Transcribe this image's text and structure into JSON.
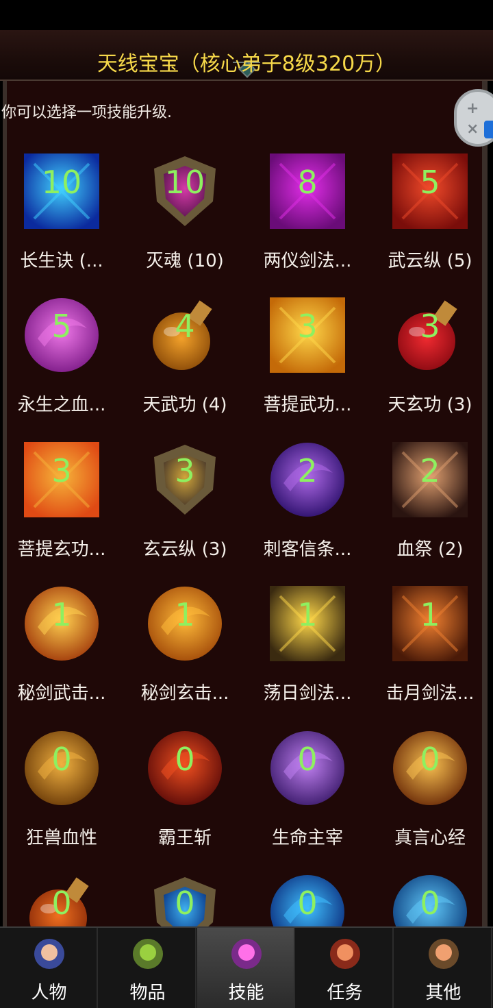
{
  "header": {
    "title": "天线宝宝（核心弟子8级320万）"
  },
  "hint": "你可以选择一项技能升级.",
  "skills": [
    {
      "name": "长生诀 (...",
      "level": "10",
      "icon": "figure-aura-icon",
      "shape": "square",
      "colors": [
        "#0b2a9e",
        "#42d2ff"
      ]
    },
    {
      "name": "灭魂 (10)",
      "level": "10",
      "icon": "gem-crest-icon",
      "shape": "crest",
      "colors": [
        "#5e1552",
        "#d63aa8"
      ]
    },
    {
      "name": "两仪剑法...",
      "level": "8",
      "icon": "crossed-swords-icon",
      "shape": "square",
      "colors": [
        "#6a0c78",
        "#e22ee8"
      ]
    },
    {
      "name": "武云纵 (5)",
      "level": "5",
      "icon": "flame-blade-icon",
      "shape": "square",
      "colors": [
        "#7a0d0a",
        "#f04a2a"
      ]
    },
    {
      "name": "永生之血...",
      "level": "5",
      "icon": "swirl-orb-icon",
      "shape": "circle",
      "colors": [
        "#7b1a86",
        "#ef78e8"
      ]
    },
    {
      "name": "天武功 (4)",
      "level": "4",
      "icon": "potion-orange-icon",
      "shape": "potion",
      "colors": [
        "#8a4a08",
        "#f2a12a"
      ]
    },
    {
      "name": "菩提武功...",
      "level": "3",
      "icon": "eye-icon",
      "shape": "square",
      "colors": [
        "#c46a08",
        "#ffd84a"
      ]
    },
    {
      "name": "天玄功 (3)",
      "level": "3",
      "icon": "potion-red-icon",
      "shape": "potion",
      "colors": [
        "#8a0a12",
        "#ef2a30"
      ]
    },
    {
      "name": "菩提玄功...",
      "level": "3",
      "icon": "fire-orb-icon",
      "shape": "square",
      "colors": [
        "#e04a14",
        "#f6b43a"
      ]
    },
    {
      "name": "玄云纵 (3)",
      "level": "3",
      "icon": "winged-crest-icon",
      "shape": "crest",
      "colors": [
        "#4b3a2a",
        "#d0a53a"
      ]
    },
    {
      "name": "刺客信条...",
      "level": "2",
      "icon": "dagger-purple-icon",
      "shape": "circle",
      "colors": [
        "#2a0f6a",
        "#b06ae8"
      ]
    },
    {
      "name": "血祭 (2)",
      "level": "2",
      "icon": "dark-wings-icon",
      "shape": "square",
      "colors": [
        "#2a1410",
        "#e0a070"
      ]
    },
    {
      "name": "秘剑武击...",
      "level": "1",
      "icon": "golden-burst-icon",
      "shape": "circle",
      "colors": [
        "#a0380a",
        "#ffd050"
      ]
    },
    {
      "name": "秘剑玄击...",
      "level": "1",
      "icon": "fists-icon",
      "shape": "circle",
      "colors": [
        "#a04808",
        "#ffbb3a"
      ]
    },
    {
      "name": "荡日剑法...",
      "level": "1",
      "icon": "sword-strike-icon",
      "shape": "square",
      "colors": [
        "#3a2a10",
        "#ffd84a"
      ]
    },
    {
      "name": "击月剑法...",
      "level": "1",
      "icon": "spear-strike-icon",
      "shape": "square",
      "colors": [
        "#4a1a08",
        "#f08030"
      ]
    },
    {
      "name": "狂兽血性",
      "level": "0",
      "icon": "beast-icon",
      "shape": "circle",
      "colors": [
        "#6a3a08",
        "#f0b040"
      ]
    },
    {
      "name": "霸王斩",
      "level": "0",
      "icon": "axe-fire-icon",
      "shape": "circle",
      "colors": [
        "#5a0a08",
        "#f05020"
      ]
    },
    {
      "name": "生命主宰",
      "level": "0",
      "icon": "warrior-purple-icon",
      "shape": "circle",
      "colors": [
        "#3a1a6a",
        "#c080f0"
      ]
    },
    {
      "name": "真言心经",
      "level": "0",
      "icon": "golden-spin-icon",
      "shape": "circle",
      "colors": [
        "#6a2a08",
        "#f8c050"
      ]
    },
    {
      "name": "",
      "level": "0",
      "icon": "potion-flame-icon",
      "shape": "potion",
      "colors": [
        "#8a2a08",
        "#f07020"
      ]
    },
    {
      "name": "",
      "level": "0",
      "icon": "blue-crest-icon",
      "shape": "crest",
      "colors": [
        "#0a3a8a",
        "#40b0f0"
      ]
    },
    {
      "name": "",
      "level": "0",
      "icon": "blue-swirl-icon",
      "shape": "circle",
      "colors": [
        "#0a2a7a",
        "#40c0ff"
      ]
    },
    {
      "name": "",
      "level": "0",
      "icon": "blue-vortex-icon",
      "shape": "circle",
      "colors": [
        "#0a3a7a",
        "#60c8f8"
      ]
    }
  ],
  "tabs": [
    {
      "label": "人物",
      "icon": "character-icon",
      "active": false
    },
    {
      "label": "物品",
      "icon": "potion-bag-icon",
      "active": false
    },
    {
      "label": "技能",
      "icon": "skill-orb-icon",
      "active": true
    },
    {
      "label": "任务",
      "icon": "quest-scroll-icon",
      "active": false
    },
    {
      "label": "其他",
      "icon": "tools-icon",
      "active": false
    }
  ],
  "colors": {
    "title": "#f7d94a",
    "level": "#8ef060",
    "panel_bg": "#1f0807",
    "text": "#f5f0ea"
  }
}
